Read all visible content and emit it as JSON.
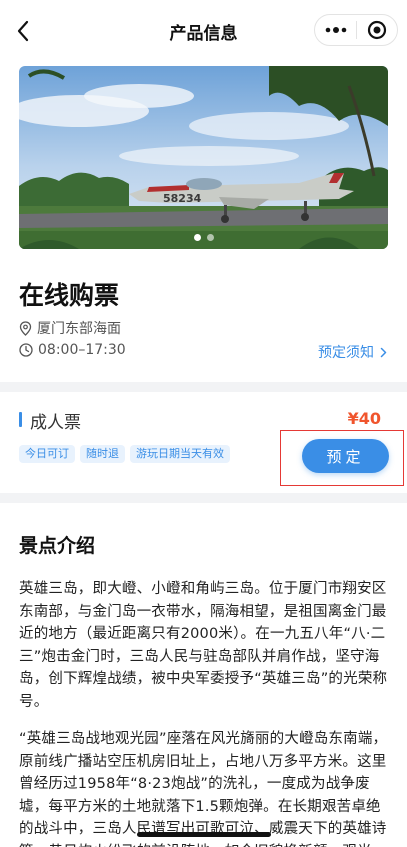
{
  "nav": {
    "title": "产品信息",
    "back_icon": "chevron-left-icon",
    "more_icon": "more-dots-icon",
    "close_icon": "target-close-icon"
  },
  "banner": {
    "slide_count": 2,
    "active_index": 0,
    "aircraft_number": "58234"
  },
  "info": {
    "title": "在线购票",
    "location": "厦门东部海面",
    "hours": "08:00–17:30",
    "notice_link": "预定须知"
  },
  "ticket": {
    "name": "成人票",
    "price": "¥40",
    "tags": [
      "今日可订",
      "随时退",
      "游玩日期当天有效"
    ],
    "book_label": "预定"
  },
  "intro": {
    "title": "景点介绍",
    "paragraph1": "英雄三岛，即大嶝、小嶝和角屿三岛。位于厦门市翔安区东南部，与金门岛一衣带水，隔海相望，是祖国离金门最近的地方（最近距离只有2000米）。在一九五八年“八·二三”炮击金门时，三岛人民与驻岛部队并肩作战，坚守海岛，创下辉煌战绩，被中央军委授予“英雄三岛”的光荣称号。",
    "paragraph2": "“英雄三岛战地观光园”座落在风光旖丽的大嶝岛东南端，原前线广播站空压机房旧址上，占地八万多平方米。这里曾经历过1958年“8·23炮战”的洗礼，一度成为战争废墟，每平方米的土地就落下1.5颗炮弹。在长期艰苦卓绝的战斗中，三岛人民谱写出可歌可泣、威震天下的英雄诗篇，昔日炮火纷飞的前沿阵地，如今旧貌换新颜，观光"
  },
  "colors": {
    "accent": "#3a8ee6",
    "price": "#f0552d",
    "highlight_frame": "#e53935",
    "divider": "#f2f3f5"
  }
}
